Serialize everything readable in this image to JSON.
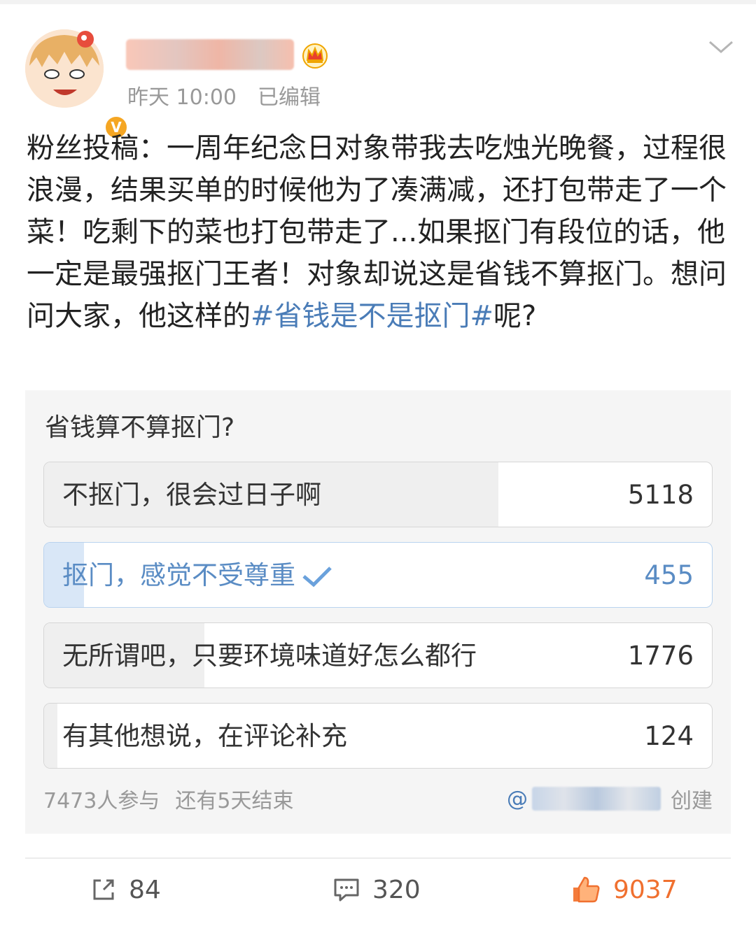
{
  "post": {
    "time": "昨天 10:00",
    "edited": "已编辑",
    "text_before": "粉丝投稿：一周年纪念日对象带我去吃烛光晚餐，过程很浪漫，结果买单的时候他为了凑满减，还打包带走了一个菜！吃剩下的菜也打包带走了...如果抠门有段位的话，他一定是最强抠门王者！对象却说这是省钱不算抠门。想问问大家，他这样的",
    "topic": "#省钱是不是抠门#",
    "text_after": "呢?"
  },
  "poll": {
    "title": "省钱算不算抠门?",
    "options": [
      {
        "label": "不抠门，很会过日子啊",
        "count": "5118",
        "fill": 0.68,
        "selected": false
      },
      {
        "label": "抠门，感觉不受尊重",
        "count": "455",
        "fill": 0.06,
        "selected": true
      },
      {
        "label": "无所谓吧，只要环境味道好怎么都行",
        "count": "1776",
        "fill": 0.24,
        "selected": false
      },
      {
        "label": "有其他想说，在评论补充",
        "count": "124",
        "fill": 0.02,
        "selected": false
      }
    ],
    "participants": "7473人参与",
    "remaining": "还有5天结束",
    "at": "@",
    "created": "创建"
  },
  "actions": {
    "repost_count": "84",
    "comment_count": "320",
    "like_count": "9037"
  },
  "colors": {
    "link": "#4a7cb7",
    "like": "#f0702f",
    "verified_badge": "#f5a623"
  },
  "icons": {
    "verified": "v-badge",
    "member": "crown-icon",
    "more": "chevron-down-icon",
    "repost": "share-icon",
    "comment": "comment-icon",
    "like": "thumbs-up-icon"
  }
}
